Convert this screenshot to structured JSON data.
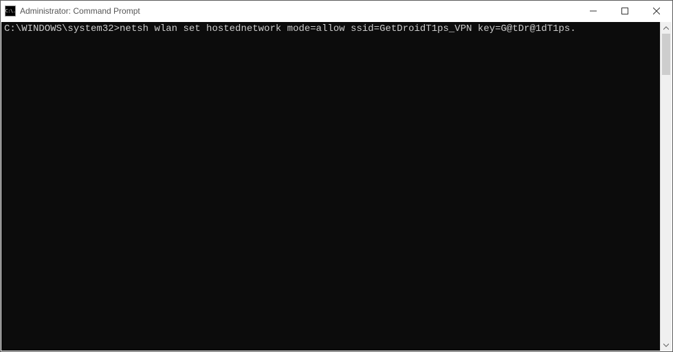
{
  "titlebar": {
    "icon_label": "C:\\.",
    "title": "Administrator: Command Prompt"
  },
  "terminal": {
    "prompt": "C:\\WINDOWS\\system32>",
    "command": "netsh wlan set hostednetwork mode=allow ssid=GetDroidT1ps_VPN key=G@tDr@1dT1ps."
  }
}
